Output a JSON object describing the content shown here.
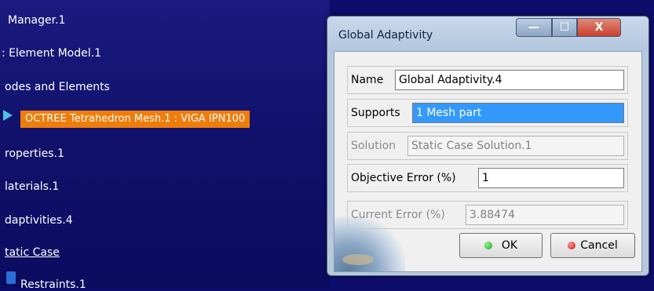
{
  "tree": {
    "items": [
      {
        "label": "Manager.1"
      },
      {
        "label": ": Element Model.1"
      },
      {
        "label": "odes and Elements"
      },
      {
        "label": "OCTREE Tetrahedron Mesh.1 : VIGA IPN100"
      },
      {
        "label": "roperties.1"
      },
      {
        "label": "laterials.1"
      },
      {
        "label": "daptivities.4"
      },
      {
        "label": "tatic Case"
      },
      {
        "label": "Restraints.1"
      }
    ]
  },
  "dialog": {
    "title": "Global Adaptivity",
    "window_buttons": {
      "minimize": "—",
      "maximize": "☐",
      "close": "X"
    },
    "fields": {
      "name": {
        "label": "Name",
        "value": "Global Adaptivity.4"
      },
      "supports": {
        "label": "Supports",
        "value": "1 Mesh part"
      },
      "solution": {
        "label": "Solution",
        "value": "Static Case Solution.1"
      },
      "objective_error": {
        "label": "Objective Error (%)",
        "value": "1"
      },
      "current_error": {
        "label": "Current Error (%)",
        "value": "3.88474"
      }
    },
    "buttons": {
      "ok": "OK",
      "cancel": "Cancel"
    }
  },
  "colors": {
    "background": "#0d0d6b",
    "highlight": "#f07d0a",
    "selection": "#3399ff",
    "dialog_frame": "#b7c9df"
  },
  "icons": [
    "mesh-icon",
    "restraint-icon",
    "ok-icon",
    "cancel-icon"
  ]
}
